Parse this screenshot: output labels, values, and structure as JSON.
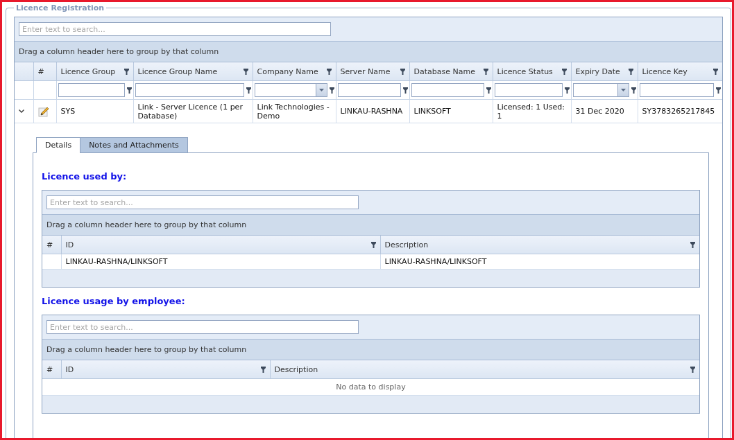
{
  "fieldset": {
    "legend": "Licence Registration"
  },
  "grid": {
    "search": {
      "placeholder": "Enter text to search..."
    },
    "group_panel": "Drag a column header here to group by that column",
    "columns": [
      {
        "label": "#",
        "kind": "none"
      },
      {
        "label": "Licence Group",
        "kind": "text"
      },
      {
        "label": "Licence Group Name",
        "kind": "text"
      },
      {
        "label": "Company Name",
        "kind": "combo"
      },
      {
        "label": "Server Name",
        "kind": "text"
      },
      {
        "label": "Database Name",
        "kind": "text"
      },
      {
        "label": "Licence Status",
        "kind": "text"
      },
      {
        "label": "Expiry Date",
        "kind": "combo"
      },
      {
        "label": "Licence Key",
        "kind": "text"
      }
    ],
    "rows": [
      {
        "expanded": true,
        "cells": [
          "",
          "SYS",
          "Link - Server Licence (1 per Database)",
          "Link Technologies - Demo",
          "LINKAU-RASHNA",
          "LINKSOFT",
          "Licensed: 1 Used: 1",
          "31 Dec 2020",
          "SY3783265217845"
        ]
      }
    ]
  },
  "detail": {
    "tabs": [
      {
        "label": "Details",
        "selected": true
      },
      {
        "label": "Notes and Attachments",
        "selected": false
      }
    ],
    "sections": [
      {
        "title": "Licence used by:",
        "grid": {
          "search": {
            "placeholder": "Enter text to search..."
          },
          "group_panel": "Drag a column header here to group by that column",
          "columns": [
            {
              "label": "#",
              "filter_icon": false
            },
            {
              "label": "ID",
              "filter_icon": true
            },
            {
              "label": "Description",
              "filter_icon": true
            }
          ],
          "rows": [
            {
              "cells": [
                "",
                "LINKAU-RASHNA/LINKSOFT",
                "LINKAU-RASHNA/LINKSOFT"
              ]
            }
          ]
        }
      },
      {
        "title": "Licence usage by employee:",
        "grid": {
          "search": {
            "placeholder": "Enter text to search..."
          },
          "group_panel": "Drag a column header here to group by that column",
          "columns": [
            {
              "label": "#",
              "filter_icon": false
            },
            {
              "label": "ID",
              "filter_icon": true
            },
            {
              "label": "Description",
              "filter_icon": true
            }
          ],
          "empty_text": "No data to display"
        }
      }
    ]
  }
}
